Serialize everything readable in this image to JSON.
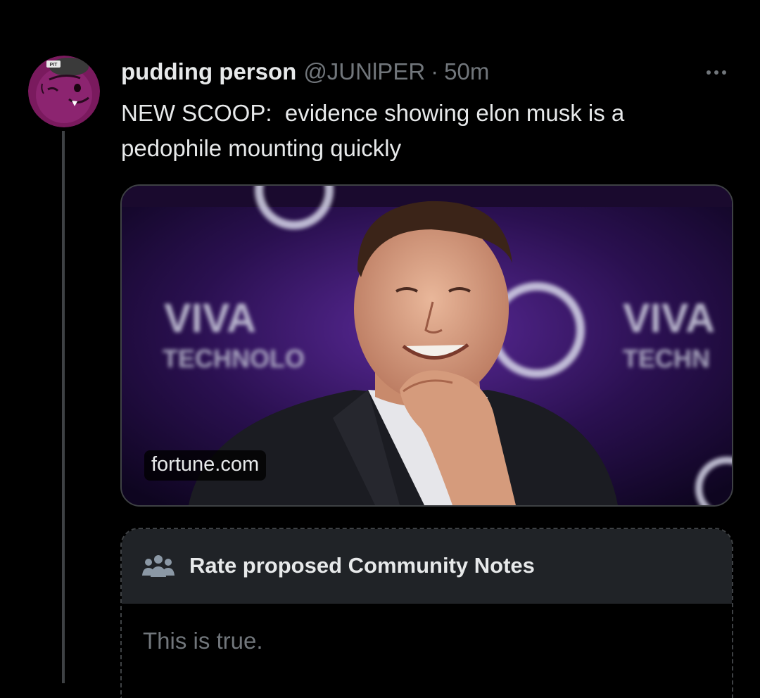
{
  "tweet": {
    "display_name": "pudding person",
    "handle": "@JUNlPER",
    "separator": "·",
    "timestamp": "50m",
    "text": "NEW SCOOP:  evidence showing elon musk is a\npedophile mounting quickly",
    "avatar_badge": "PIT"
  },
  "card": {
    "domain": "fortune.com",
    "backdrop_texts": [
      "VIVA",
      "TECHNOLO",
      "VIVA",
      "TECHN"
    ]
  },
  "community_notes": {
    "title": "Rate proposed Community Notes",
    "note_text": "This is true."
  },
  "colors": {
    "background": "#000000",
    "primary_text": "#e7e9ea",
    "secondary_text": "#71767b",
    "border": "#3e4144",
    "notes_header_bg": "#202327",
    "avatar_purple": "#7a1a5e"
  },
  "icons": {
    "more": "more-horizontal-icon",
    "community_notes": "people-group-icon"
  }
}
